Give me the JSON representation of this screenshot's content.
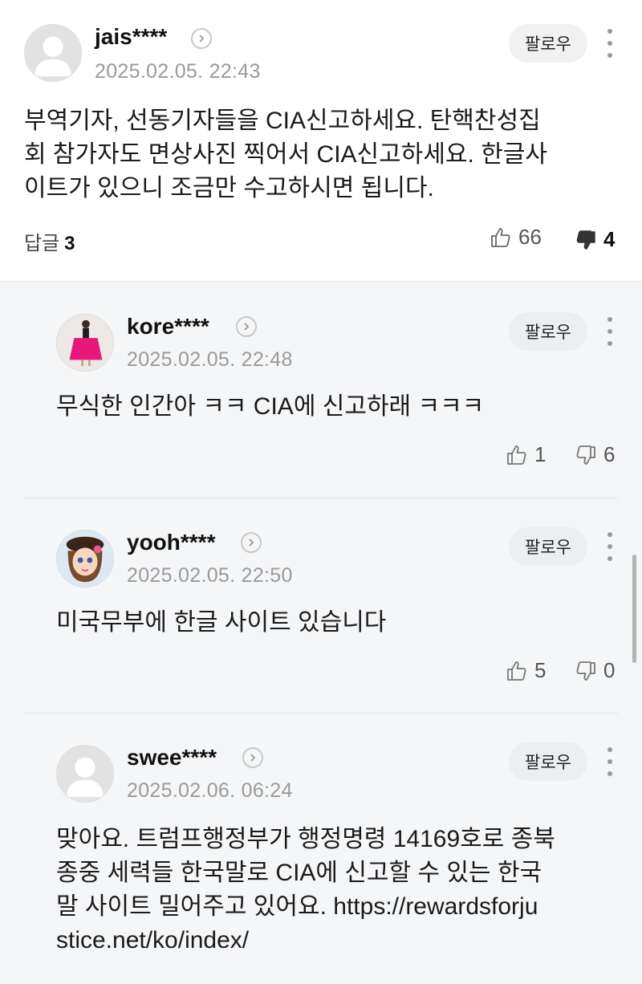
{
  "comments": [
    {
      "nick": "jais****",
      "date": "2025.02.05. 22:43",
      "follow_label": "팔로우",
      "lines": [
        "부역기자, 선동기자들을 CIA신고하세요. 탄핵찬성집",
        "회 참가자도 면상사진 찍어서 CIA신고하세요. 한글사",
        "이트가 있으니 조금만 수고하시면 됩니다."
      ],
      "reply_label": "답글",
      "reply_count": "3",
      "likes": "66",
      "dislikes": "4"
    }
  ],
  "replies": [
    {
      "nick": "kore****",
      "date": "2025.02.05. 22:48",
      "follow_label": "팔로우",
      "lines": [
        "무식한 인간아 ㅋㅋ CIA에 신고하래 ㅋㅋㅋ"
      ],
      "likes": "1",
      "dislikes": "6"
    },
    {
      "nick": "yooh****",
      "date": "2025.02.05. 22:50",
      "follow_label": "팔로우",
      "lines": [
        "미국무부에 한글 사이트 있습니다"
      ],
      "likes": "5",
      "dislikes": "0"
    },
    {
      "nick": "swee****",
      "date": "2025.02.06. 06:24",
      "follow_label": "팔로우",
      "lines": [
        "맞아요. 트럼프행정부가 행정명령 14169호로 종북",
        "종중 세력들 한국말로 CIA에 신고할 수 있는 한국",
        "말 사이트 밀어주고 있어요. https://rewardsforju",
        "stice.net/ko/index/"
      ]
    }
  ],
  "icons": {
    "avatar_default": "default-avatar-icon",
    "arrow": "chevron-right-icon",
    "more": "more-vertical-icon",
    "like": "thumbs-up-icon",
    "dislike": "thumbs-down-icon"
  },
  "colors": {
    "reply_background": "#f5f6f8",
    "follow_button": "#f1f1f1",
    "meta_gray": "#9a9a9a"
  }
}
